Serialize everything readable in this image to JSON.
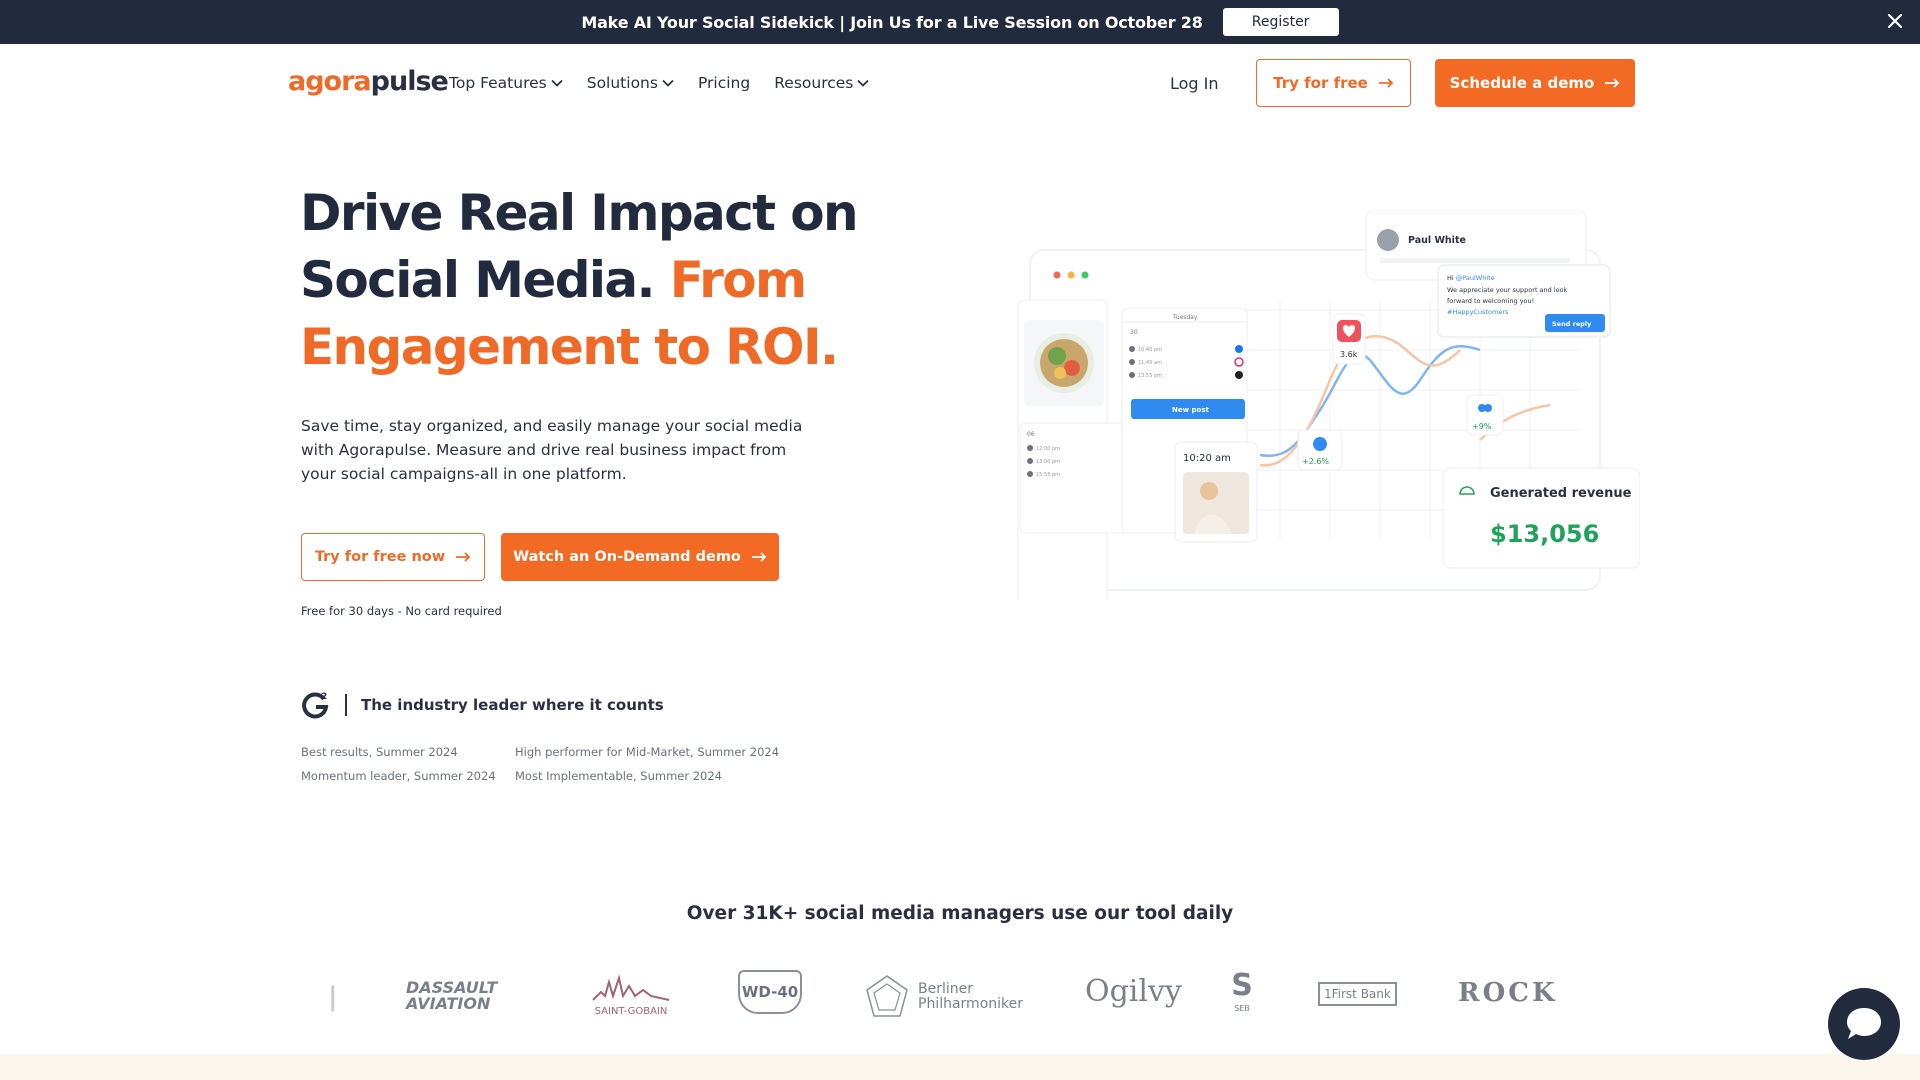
{
  "announcement": {
    "text": "Make AI Your Social Sidekick | Join Us for a Live Session on October 28",
    "register_label": "Register"
  },
  "nav": {
    "logo_part1": "agora",
    "logo_part2": "pulse",
    "menu": [
      {
        "label": "Top Features",
        "has_dropdown": true
      },
      {
        "label": "Solutions",
        "has_dropdown": true
      },
      {
        "label": "Pricing",
        "has_dropdown": false
      },
      {
        "label": "Resources",
        "has_dropdown": true
      }
    ],
    "login_label": "Log In",
    "try_free_label": "Try for free",
    "schedule_demo_label": "Schedule a demo"
  },
  "hero": {
    "title_dark": "Drive Real Impact on Social Media.",
    "title_orange": "From Engagement to ROI.",
    "description": "Save time, stay organized, and easily manage your social media with Agorapulse. Measure and drive real business impact from your social campaigns-all in one platform.",
    "cta_try": "Try for free now",
    "cta_demo": "Watch an On-Demand demo",
    "free_note": "Free for 30 days - No card required"
  },
  "g2": {
    "tagline": "The industry leader where it counts",
    "awards": [
      "Best results, Summer 2024",
      "High performer for Mid-Market, Summer 2024",
      "Momentum leader, Summer 2024",
      "Most Implementable, Summer 2024"
    ]
  },
  "illustration": {
    "profile_name": "Paul White",
    "reply_greeting": "Hi",
    "reply_handle": "@PaulWhite",
    "reply_text": "We appreciate your support and look forward to welcoming you!",
    "reply_hashtag": "#HappyCustomers",
    "send_reply_label": "Send reply",
    "calendar_day": "Tuesday",
    "calendar_date": "30",
    "calendar_date2": "06",
    "times_top": [
      "10:40 pm",
      "11:45 am",
      "13:55 pm"
    ],
    "times_bottom": [
      "12:00 pm",
      "13:00 pm",
      "15:55 pm"
    ],
    "new_post_label": "New post",
    "likes": "3.6k",
    "stat1": "+2.6%",
    "stat2": "+9%",
    "story_time": "10:20 am",
    "revenue_label": "Generated revenue",
    "revenue_value": "$13,056",
    "colors": {
      "accent": "#f06a27",
      "navy": "#222a3e",
      "blue": "#2f8bf0",
      "green": "#1fa35a"
    }
  },
  "social_proof": {
    "title": "Over 31K+ social media managers use our tool daily",
    "brands": [
      "DASSAULT AVIATION",
      "SAINT-GOBAIN",
      "WD-40",
      "Berliner Philharmoniker",
      "Ogilvy",
      "SEB",
      "1First Bank",
      "ROCK"
    ]
  },
  "chat_icon": "chat-bubble-icon"
}
